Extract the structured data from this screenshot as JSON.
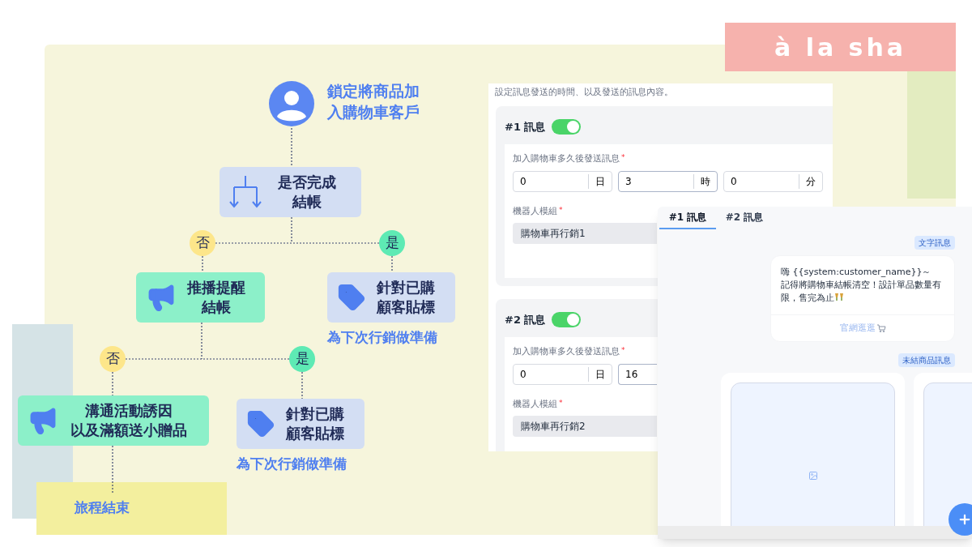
{
  "logo": {
    "text": "à la sha"
  },
  "flowchart": {
    "nodes": [
      {
        "kind": "start",
        "lines": [
          "鎖定將商品加",
          "入購物車客戶"
        ]
      },
      {
        "kind": "decision",
        "lines": [
          "是否完成",
          "結帳"
        ]
      },
      {
        "kind": "action",
        "lines": [
          "推播提醒",
          "結帳"
        ]
      },
      {
        "kind": "tag",
        "lines": [
          "針對已購",
          "顧客貼標"
        ],
        "caption": "為下次行銷做準備"
      },
      {
        "kind": "action",
        "lines": [
          "溝通活動誘因",
          "以及滿額送小贈品"
        ]
      },
      {
        "kind": "tag",
        "lines": [
          "針對已購",
          "顧客貼標"
        ],
        "caption": "為下次行銷做準備"
      },
      {
        "kind": "end",
        "lines": [
          "旅程結束"
        ]
      }
    ],
    "branches": [
      {
        "kind": "no",
        "label": "否"
      },
      {
        "kind": "yes",
        "label": "是"
      },
      {
        "kind": "no",
        "label": "否"
      },
      {
        "kind": "yes",
        "label": "是"
      }
    ]
  },
  "settings_panel": {
    "description": "設定訊息發送的時間、以及發送的訊息內容。",
    "messages": [
      {
        "title": "#1 訊息",
        "enabled": true,
        "delay_label": "加入購物車多久後發送訊息",
        "required_mark": "*",
        "delay_fields": [
          {
            "value": "0",
            "unit": "日",
            "focused": false
          },
          {
            "value": "3",
            "unit": "時",
            "focused": true
          },
          {
            "value": "0",
            "unit": "分",
            "focused": false
          }
        ],
        "module_label": "機器人模組",
        "module_value": "購物車再行銷1"
      },
      {
        "title": "#2 訊息",
        "enabled": true,
        "delay_label": "加入購物車多久後發送訊息",
        "required_mark": "*",
        "delay_fields": [
          {
            "value": "0",
            "unit": "日",
            "focused": false
          },
          {
            "value": "16",
            "focused": true
          }
        ],
        "module_label": "機器人模組",
        "module_value": "購物車再行銷2"
      }
    ]
  },
  "preview_panel": {
    "tabs": [
      {
        "label": "#1 訊息",
        "selected": true
      },
      {
        "label": "#2 訊息",
        "selected": false
      }
    ],
    "messages": [
      {
        "kind": "text",
        "tag": "文字訊息",
        "lines": [
          "嗨 {{system:customer_name}}～",
          "記得將購物車結帳清空！設計單品數量有限，售完為止"
        ],
        "button": "官網逛逛"
      },
      {
        "kind": "products",
        "tag": "未結商品訊息",
        "cards": [
          {
            "kind": "image_placeholder"
          },
          {
            "kind": "cut_off_card"
          }
        ]
      }
    ]
  }
}
